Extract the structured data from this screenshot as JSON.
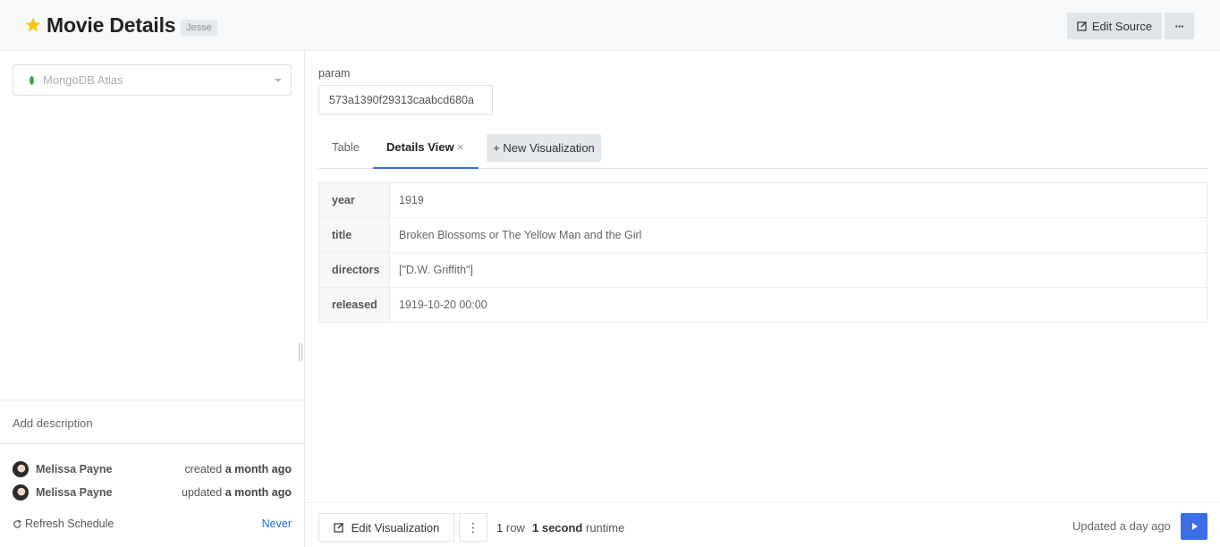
{
  "header": {
    "title": "Movie Details",
    "owner_tag": "Jesse",
    "edit_source_label": "Edit Source",
    "more_label": "···",
    "star_color": "#f5c518"
  },
  "sidebar": {
    "data_source": "MongoDB Atlas",
    "description_placeholder": "Add description",
    "meta": [
      {
        "name": "Melissa Payne",
        "action": "created",
        "when": "a month ago"
      },
      {
        "name": "Melissa Payne",
        "action": "updated",
        "when": "a month ago"
      }
    ],
    "refresh_label": "Refresh Schedule",
    "refresh_value": "Never"
  },
  "params": {
    "label": "param",
    "value": "573a1390f29313caabcd680a"
  },
  "tabs": {
    "table_label": "Table",
    "details_label": "Details View",
    "close_glyph": "×",
    "new_viz_label": "+ New Visualization"
  },
  "details": {
    "rows": [
      {
        "key": "year",
        "value": "1919"
      },
      {
        "key": "title",
        "value": "Broken Blossoms or The Yellow Man and the Girl"
      },
      {
        "key": "directors",
        "value": "[\"D.W. Griffith\"]"
      },
      {
        "key": "released",
        "value": "1919-10-20 00:00"
      }
    ]
  },
  "footer": {
    "edit_viz_label": "Edit Visualization",
    "kebab_label": "⋮",
    "row_count": "1",
    "row_word": "row",
    "runtime_value": "1 second",
    "runtime_word": "runtime",
    "updated": "Updated a day ago",
    "accent": "#3a6fe8"
  }
}
